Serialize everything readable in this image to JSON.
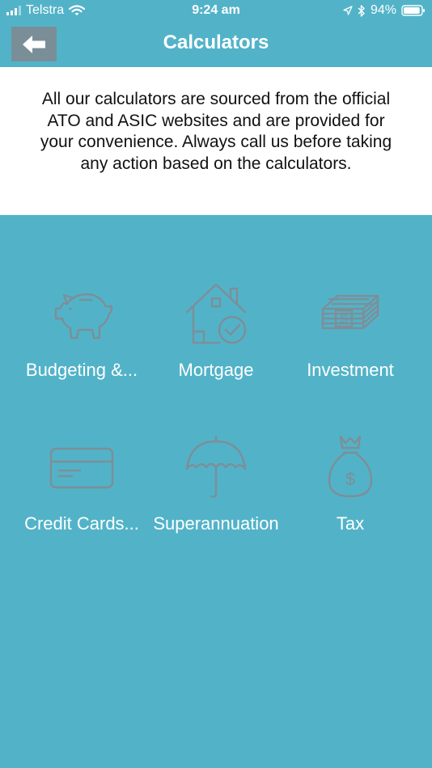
{
  "status_bar": {
    "carrier": "Telstra",
    "time": "9:24 am",
    "battery_percent": "94%",
    "battery_level": 0.94
  },
  "header": {
    "title": "Calculators",
    "back_icon": "arrow-left-icon"
  },
  "notice": {
    "text": "All our calculators are sourced from the official ATO and ASIC websites and are provided for your convenience. Always call us before taking any action based on the calculators."
  },
  "calculators": [
    {
      "label": "Budgeting &...",
      "icon": "piggy-bank-icon"
    },
    {
      "label": "Mortgage",
      "icon": "house-check-icon"
    },
    {
      "label": "Investment",
      "icon": "money-stack-icon"
    },
    {
      "label": "Credit Cards...",
      "icon": "credit-card-icon"
    },
    {
      "label": "Superannuation",
      "icon": "umbrella-icon"
    },
    {
      "label": "Tax",
      "icon": "money-bag-icon"
    }
  ],
  "colors": {
    "background": "#52B3C8",
    "notice_background": "#FFFFFF",
    "icon_stroke": "#7C8F99",
    "back_button": "#7A8E98"
  }
}
